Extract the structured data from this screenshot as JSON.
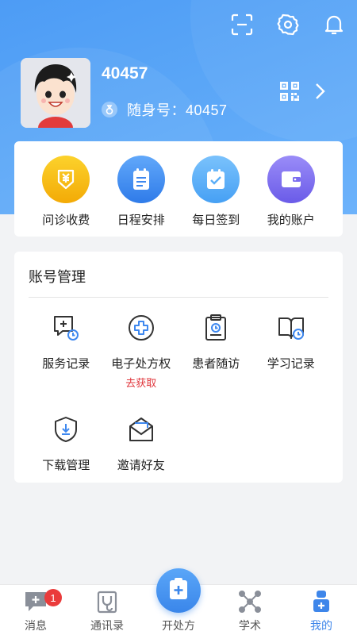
{
  "user": {
    "name": "40457",
    "id_label": "随身号：40457"
  },
  "quick_actions": [
    {
      "label": "问诊收费",
      "icon": "yen-card-icon",
      "color": "#f5b60f"
    },
    {
      "label": "日程安排",
      "icon": "schedule-icon",
      "color": "#3e88ef"
    },
    {
      "label": "每日签到",
      "icon": "checkin-icon",
      "color": "#5aaef7"
    },
    {
      "label": "我的账户",
      "icon": "wallet-icon",
      "color": "#7b6df0"
    }
  ],
  "account": {
    "title": "账号管理",
    "items": [
      {
        "label": "服务记录",
        "icon": "service-record-icon"
      },
      {
        "label": "电子处方权",
        "icon": "prescription-icon",
        "sub": "去获取"
      },
      {
        "label": "患者随访",
        "icon": "patient-followup-icon"
      },
      {
        "label": "学习记录",
        "icon": "study-record-icon"
      },
      {
        "label": "下载管理",
        "icon": "download-shield-icon"
      },
      {
        "label": "邀请好友",
        "icon": "invite-mail-icon"
      }
    ]
  },
  "tabs": [
    {
      "label": "消息",
      "badge": "1"
    },
    {
      "label": "通讯录"
    },
    {
      "label": "开处方"
    },
    {
      "label": "学术"
    },
    {
      "label": "我的",
      "active": true
    }
  ],
  "colors": {
    "primary": "#4d9cf5",
    "accent_red": "#e0353b",
    "active_tab": "#3e86ea"
  }
}
